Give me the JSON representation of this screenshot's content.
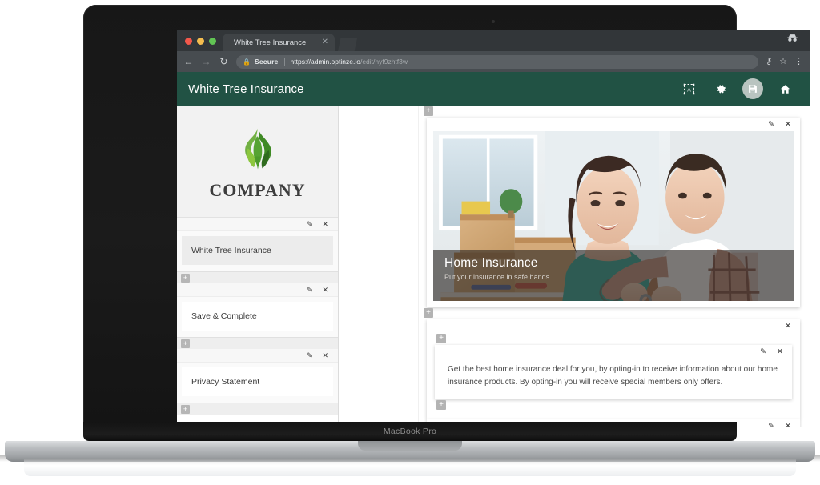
{
  "device": {
    "model_label": "MacBook Pro"
  },
  "browser": {
    "tab": {
      "title": "White Tree Insurance",
      "close_icon": "close-icon"
    },
    "toolbar": {
      "back_icon": "arrow-back-icon",
      "forward_icon": "arrow-forward-icon",
      "reload_icon": "reload-icon",
      "lock_icon": "lock-icon",
      "secure_label": "Secure",
      "url_origin": "https://admin.optinze.io",
      "url_path": "/edit/hyf9zhtf3w",
      "key_icon": "key-icon",
      "star_icon": "star-icon",
      "menu_icon": "three-dot-menu-icon"
    },
    "incognito_icon": "incognito-icon",
    "traffic_lights": [
      "close",
      "minimize",
      "maximize"
    ]
  },
  "app": {
    "header": {
      "title": "White Tree Insurance",
      "accent_color": "#215244",
      "actions": [
        {
          "name": "layout-frame-icon",
          "label": "Layout"
        },
        {
          "name": "gear-icon",
          "label": "Settings"
        },
        {
          "name": "save-icon",
          "label": "Save"
        },
        {
          "name": "home-icon",
          "label": "Home"
        }
      ]
    },
    "sidebar": {
      "logo": {
        "mark": "tree-leaf-logo-icon",
        "text": "COMPANY",
        "colors": [
          "#8bc34a",
          "#4c9a2a",
          "#2f6b1e"
        ]
      },
      "blocks": [
        {
          "label": "White Tree Insurance",
          "edit_icon": "pencil-icon",
          "close_icon": "close-icon",
          "style": "filled"
        },
        {
          "label": "Save & Complete",
          "edit_icon": "pencil-icon",
          "close_icon": "close-icon",
          "style": "plain"
        },
        {
          "label": "Privacy Statement",
          "edit_icon": "pencil-icon",
          "close_icon": "close-icon",
          "style": "plain"
        }
      ],
      "add_label": "+"
    },
    "canvas": {
      "add_label": "+",
      "hero": {
        "title": "Home Insurance",
        "subtitle": "Put your insurance in safe hands",
        "edit_icon": "pencil-icon",
        "close_icon": "close-icon",
        "image_alt": "couple-holding-keys-with-moving-boxes"
      },
      "text_block": {
        "paragraph": "Get the best home insurance deal for you, by opting-in to receive information about our home insurance products. By opting-in you will receive special members only offers.",
        "edit_icon": "pencil-icon",
        "close_icon": "close-icon",
        "outer_close_icon": "close-icon"
      }
    }
  }
}
